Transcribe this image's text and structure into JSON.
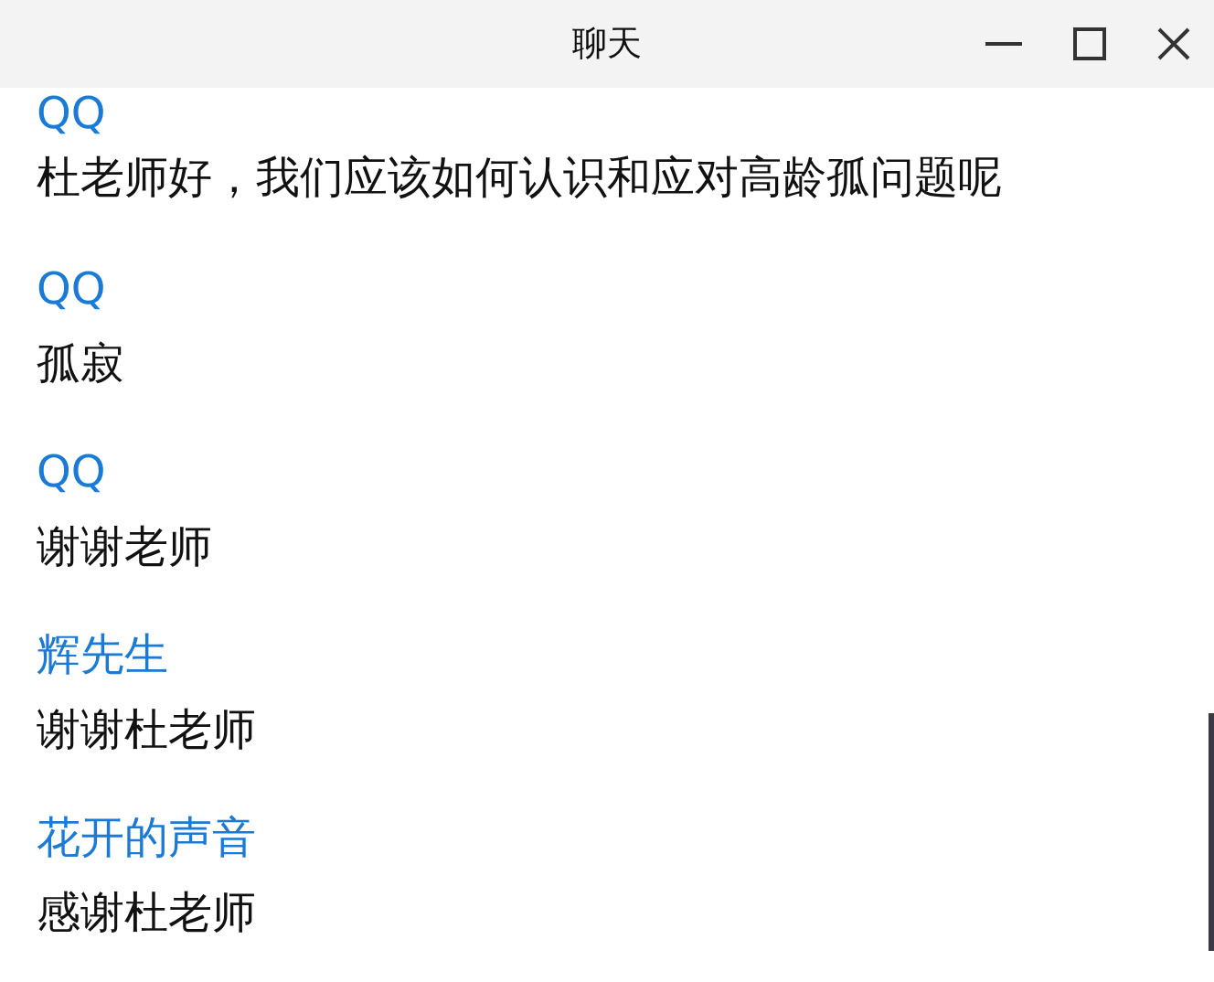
{
  "window": {
    "title": "聊天"
  },
  "messages": [
    {
      "sender": "QQ",
      "text": "杜老师好，我们应该如何认识和应对高龄孤问题呢"
    },
    {
      "sender": "QQ",
      "text": "孤寂"
    },
    {
      "sender": "QQ",
      "text": "谢谢老师"
    },
    {
      "sender": "辉先生",
      "text": "谢谢杜老师"
    },
    {
      "sender": "花开的声音",
      "text": "感谢杜老师"
    }
  ]
}
